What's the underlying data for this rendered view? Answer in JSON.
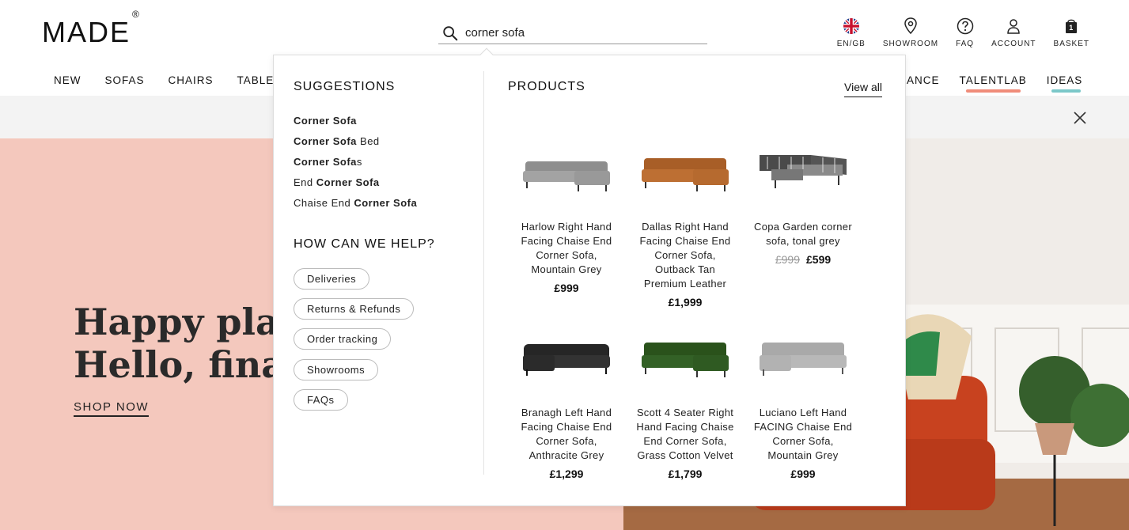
{
  "brand": {
    "logo_text": "MADE",
    "logo_mark": "®"
  },
  "search": {
    "value": "corner sofa"
  },
  "utils": [
    {
      "label": "EN/GB",
      "icon": "uk-flag-icon"
    },
    {
      "label": "SHOWROOM",
      "icon": "location-pin-icon"
    },
    {
      "label": "FAQ",
      "icon": "question-icon"
    },
    {
      "label": "ACCOUNT",
      "icon": "user-icon"
    },
    {
      "label": "BASKET",
      "icon": "basket-icon",
      "count": "1"
    }
  ],
  "nav": {
    "left": [
      "NEW",
      "SOFAS",
      "CHAIRS",
      "TABLES"
    ],
    "right": [
      "ANCE",
      "TALENTLAB",
      "IDEAS"
    ]
  },
  "hero": {
    "title_line1": "Happy plac",
    "title_line2": "Hello, fina",
    "cta": "SHOP NOW"
  },
  "dropdown": {
    "suggestions_title": "SUGGESTIONS",
    "suggestions": [
      {
        "bold": "Corner Sofa",
        "rest": ""
      },
      {
        "bold": "Corner Sofa",
        "rest": " Bed"
      },
      {
        "bold": "Corner Sofa",
        "rest": "s"
      },
      {
        "pre": "End ",
        "bold": "Corner Sofa",
        "rest": ""
      },
      {
        "pre": "Chaise End ",
        "bold": "Corner Sofa",
        "rest": ""
      }
    ],
    "help_title": "HOW CAN WE HELP?",
    "help_links": [
      "Deliveries",
      "Returns & Refunds",
      "Order tracking",
      "Showrooms",
      "FAQs"
    ],
    "products_title": "PRODUCTS",
    "view_all": "View all",
    "products": [
      {
        "name": "Harlow Right Hand Facing Chaise End Corner Sofa, Mountain Grey",
        "price": "£999",
        "color": "#9a9a9a"
      },
      {
        "name": "Dallas Right Hand Facing Chaise End Corner Sofa, Outback Tan Premium Leather",
        "price": "£1,999",
        "color": "#b5692f"
      },
      {
        "name": "Copa Garden corner sofa, tonal grey",
        "old_price": "£999",
        "price": "£599",
        "color": "#5c5c5c"
      },
      {
        "name": "Branagh Left Hand Facing Chaise End Corner Sofa, Anthracite Grey",
        "price": "£1,299",
        "color": "#2e2e2e"
      },
      {
        "name": "Scott 4 Seater Right Hand Facing Chaise End Corner Sofa, Grass Cotton Velvet",
        "price": "£1,799",
        "color": "#2f5a1f"
      },
      {
        "name": "Luciano Left Hand FACING Chaise End Corner Sofa, Mountain Grey",
        "price": "£999",
        "color": "#b0b0b0"
      }
    ]
  },
  "colors": {
    "hero_pink": "#f4c8bd",
    "accent_red": "#f08c7a",
    "accent_teal": "#7cc8c9"
  }
}
